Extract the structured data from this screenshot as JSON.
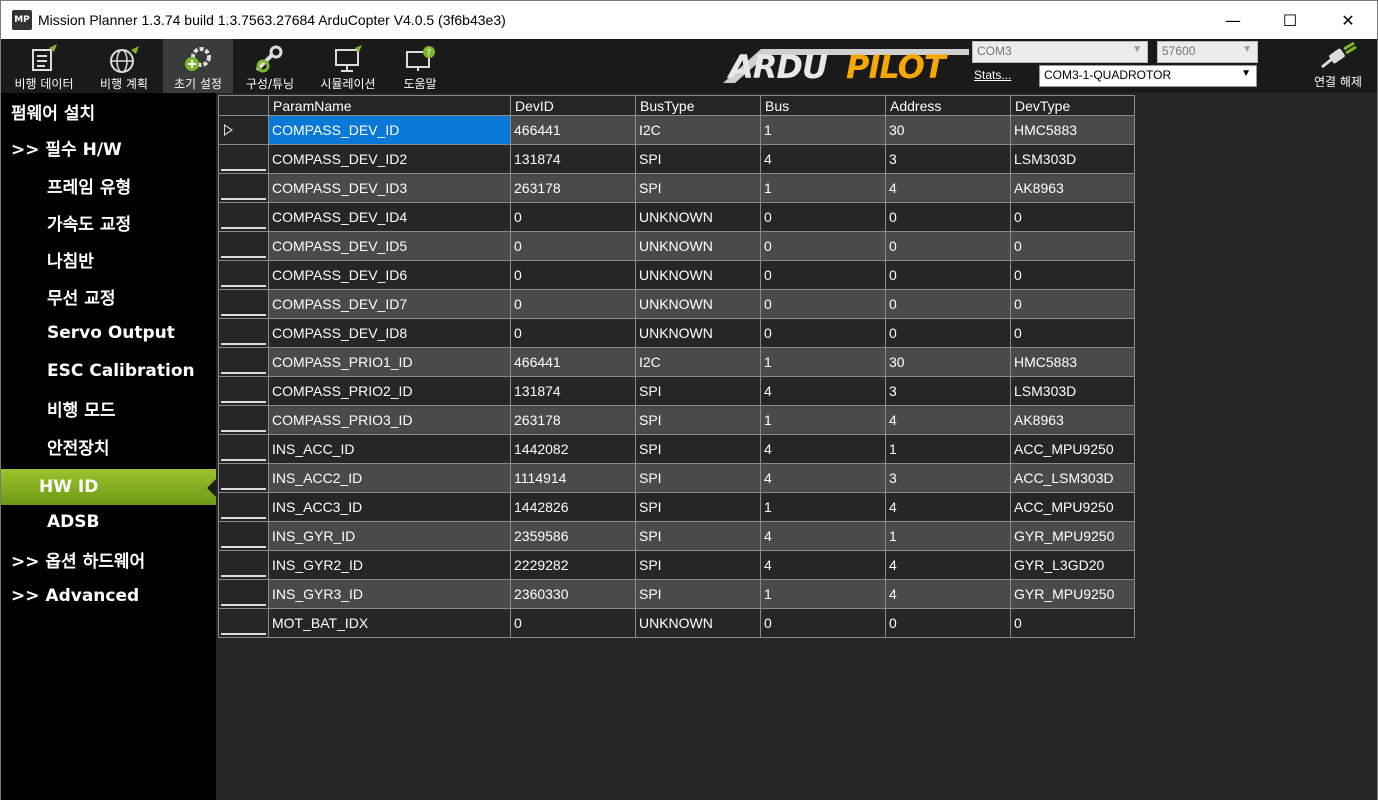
{
  "window": {
    "title": "Mission Planner 1.3.74 build 1.3.7563.27684 ArduCopter V4.0.5 (3f6b43e3)",
    "icon_text": "MP",
    "minimize": "—",
    "maximize": "☐",
    "close": "✕"
  },
  "toolbar": {
    "items": [
      {
        "label": "비행 데이터",
        "icon": "flight-data-icon"
      },
      {
        "label": "비행 계획",
        "icon": "flight-plan-icon"
      },
      {
        "label": "초기 설정",
        "icon": "initial-setup-icon"
      },
      {
        "label": "구성/튜닝",
        "icon": "config-tuning-icon"
      },
      {
        "label": "시뮬레이션",
        "icon": "simulation-icon"
      },
      {
        "label": "도움말",
        "icon": "help-icon"
      }
    ],
    "logo_text": "ARDUPILOT",
    "port": "COM3",
    "baud": "57600",
    "stats_link": "Stats...",
    "connection": "COM3-1-QUADROTOR",
    "disconnect_label": "연결 해제",
    "accent_color": "#f6a800"
  },
  "sidebar": {
    "items": [
      {
        "label": "펌웨어 설치",
        "indent": 0
      },
      {
        "label": ">> 필수 H/W",
        "indent": 0
      },
      {
        "label": "프레임 유형",
        "indent": 1
      },
      {
        "label": "가속도 교정",
        "indent": 1
      },
      {
        "label": "나침반",
        "indent": 1
      },
      {
        "label": "무선 교정",
        "indent": 1
      },
      {
        "label": "Servo Output",
        "indent": 1
      },
      {
        "label": "ESC Calibration",
        "indent": 1
      },
      {
        "label": "비행 모드",
        "indent": 1
      },
      {
        "label": "안전장치",
        "indent": 1
      },
      {
        "label": "HW ID",
        "indent": 1,
        "active": true
      },
      {
        "label": "ADSB",
        "indent": 1
      },
      {
        "label": ">> 옵션 하드웨어",
        "indent": 0
      },
      {
        "label": ">> Advanced",
        "indent": 0
      }
    ],
    "active_color": "#86b01f"
  },
  "grid": {
    "columns": [
      "ParamName",
      "DevID",
      "BusType",
      "Bus",
      "Address",
      "DevType"
    ],
    "rows": [
      [
        "COMPASS_DEV_ID",
        "466441",
        "I2C",
        "1",
        "30",
        "HMC5883"
      ],
      [
        "COMPASS_DEV_ID2",
        "131874",
        "SPI",
        "4",
        "3",
        "LSM303D"
      ],
      [
        "COMPASS_DEV_ID3",
        "263178",
        "SPI",
        "1",
        "4",
        "AK8963"
      ],
      [
        "COMPASS_DEV_ID4",
        "0",
        "UNKNOWN",
        "0",
        "0",
        "0"
      ],
      [
        "COMPASS_DEV_ID5",
        "0",
        "UNKNOWN",
        "0",
        "0",
        "0"
      ],
      [
        "COMPASS_DEV_ID6",
        "0",
        "UNKNOWN",
        "0",
        "0",
        "0"
      ],
      [
        "COMPASS_DEV_ID7",
        "0",
        "UNKNOWN",
        "0",
        "0",
        "0"
      ],
      [
        "COMPASS_DEV_ID8",
        "0",
        "UNKNOWN",
        "0",
        "0",
        "0"
      ],
      [
        "COMPASS_PRIO1_ID",
        "466441",
        "I2C",
        "1",
        "30",
        "HMC5883"
      ],
      [
        "COMPASS_PRIO2_ID",
        "131874",
        "SPI",
        "4",
        "3",
        "LSM303D"
      ],
      [
        "COMPASS_PRIO3_ID",
        "263178",
        "SPI",
        "1",
        "4",
        "AK8963"
      ],
      [
        "INS_ACC_ID",
        "1442082",
        "SPI",
        "4",
        "1",
        "ACC_MPU9250"
      ],
      [
        "INS_ACC2_ID",
        "1114914",
        "SPI",
        "4",
        "3",
        "ACC_LSM303D"
      ],
      [
        "INS_ACC3_ID",
        "1442826",
        "SPI",
        "1",
        "4",
        "ACC_MPU9250"
      ],
      [
        "INS_GYR_ID",
        "2359586",
        "SPI",
        "4",
        "1",
        "GYR_MPU9250"
      ],
      [
        "INS_GYR2_ID",
        "2229282",
        "SPI",
        "4",
        "4",
        "GYR_L3GD20"
      ],
      [
        "INS_GYR3_ID",
        "2360330",
        "SPI",
        "1",
        "4",
        "GYR_MPU9250"
      ],
      [
        "MOT_BAT_IDX",
        "0",
        "UNKNOWN",
        "0",
        "0",
        "0"
      ]
    ],
    "selected_color": "#0a78d7"
  }
}
